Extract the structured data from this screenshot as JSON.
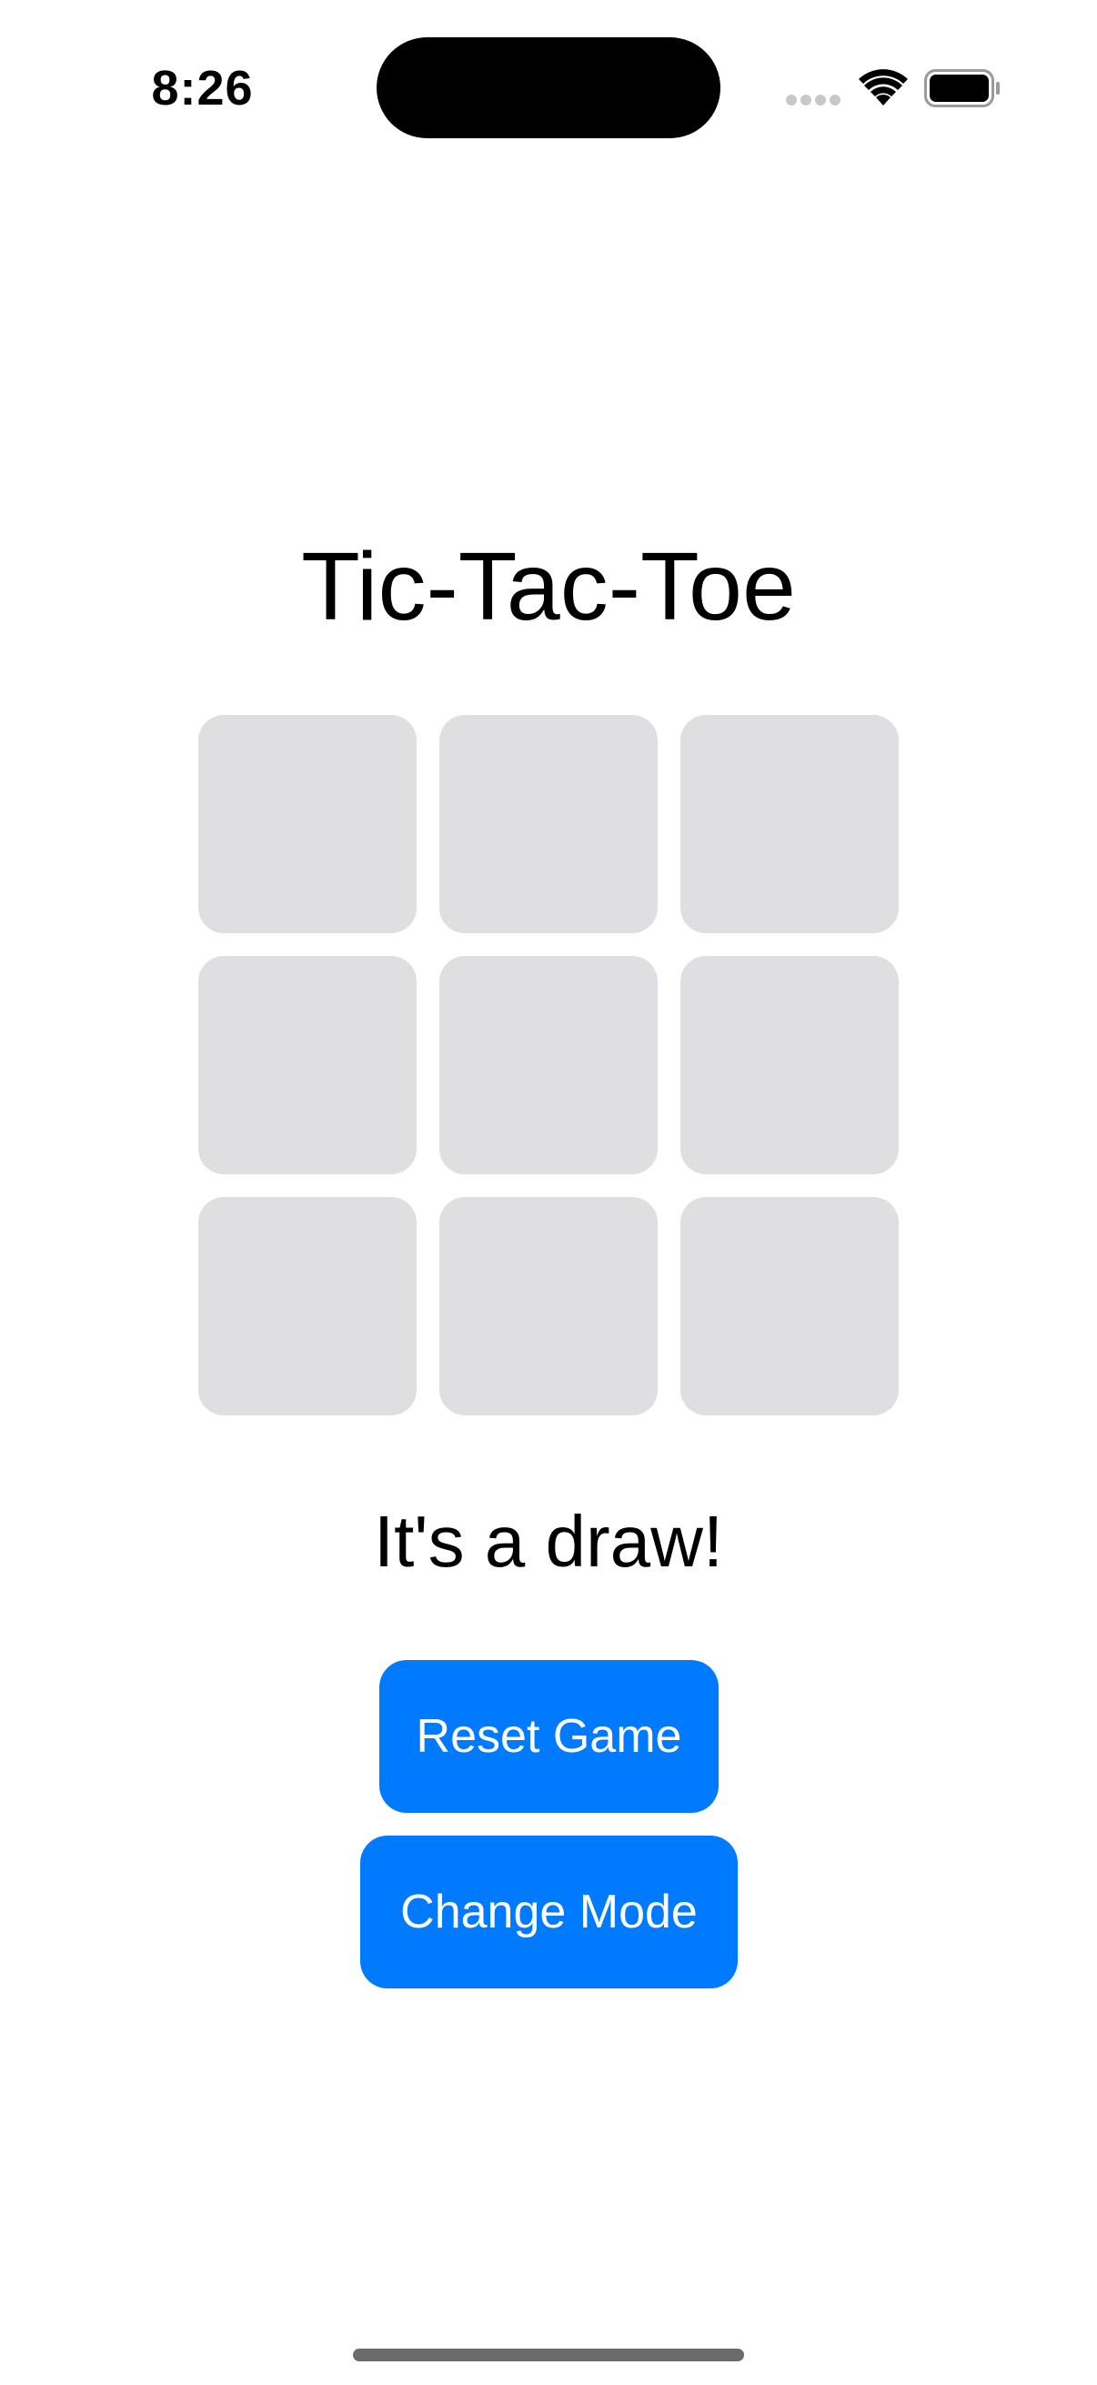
{
  "status_bar": {
    "time": "8:26",
    "icons": [
      "cellular-signal-icon",
      "wifi-icon",
      "battery-icon"
    ]
  },
  "app": {
    "title": "Tic-Tac-Toe",
    "board": {
      "cells": [
        "",
        "",
        "",
        "",
        "",
        "",
        "",
        "",
        ""
      ]
    },
    "status": "It's a draw!",
    "buttons": {
      "reset": "Reset Game",
      "change_mode": "Change Mode"
    }
  },
  "colors": {
    "accent": "#007aff",
    "cell_background": "#dfdfe1",
    "background": "#ffffff",
    "text": "#000000"
  }
}
